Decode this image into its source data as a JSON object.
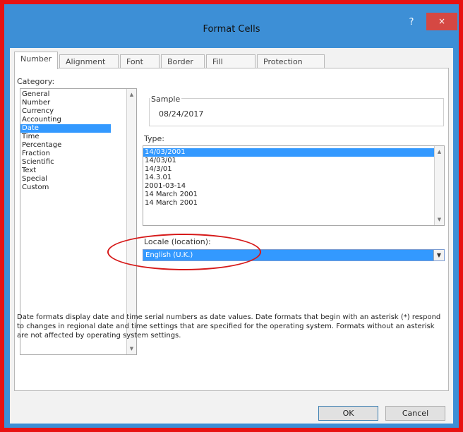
{
  "dialog": {
    "title": "Format Cells",
    "help_label": "?",
    "close_label": "×"
  },
  "tabs": [
    {
      "label": "Number"
    },
    {
      "label": "Alignment"
    },
    {
      "label": "Font"
    },
    {
      "label": "Border"
    },
    {
      "label": "Fill"
    },
    {
      "label": "Protection"
    }
  ],
  "category": {
    "label": "Category:",
    "items": [
      "General",
      "Number",
      "Currency",
      "Accounting",
      "Date",
      "Time",
      "Percentage",
      "Fraction",
      "Scientific",
      "Text",
      "Special",
      "Custom"
    ],
    "selected": "Date"
  },
  "sample": {
    "label": "Sample",
    "value": "08/24/2017"
  },
  "type": {
    "label": "Type:",
    "items": [
      "14/03/2001",
      "14/03/01",
      "14/3/01",
      "14.3.01",
      "2001-03-14",
      "14 March 2001",
      "14 March 2001"
    ],
    "selected": "14/03/2001"
  },
  "locale": {
    "label": "Locale (location):",
    "value": "English (U.K.)"
  },
  "description": "Date formats display date and time serial numbers as date values. Date formats that begin with an asterisk (*) respond to changes in regional date and time settings that are specified for the operating system. Formats without an asterisk are not affected by operating system settings.",
  "buttons": {
    "ok": "OK",
    "cancel": "Cancel"
  },
  "colors": {
    "frame": "#e81212",
    "titlebar": "#3d8fd6",
    "selection": "#3399ff",
    "close": "#d54843",
    "annotation": "#d61a1a"
  }
}
